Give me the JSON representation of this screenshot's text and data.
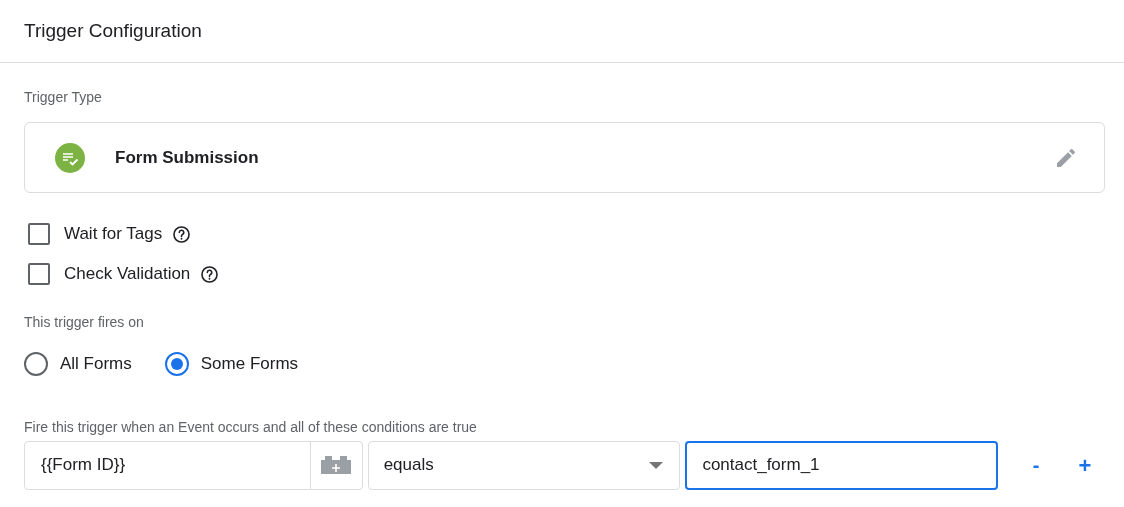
{
  "header": {
    "title": "Trigger Configuration"
  },
  "trigger_type": {
    "label": "Trigger Type",
    "name": "Form Submission"
  },
  "options": [
    {
      "label": "Wait for Tags",
      "checked": false
    },
    {
      "label": "Check Validation",
      "checked": false
    }
  ],
  "fires_on": {
    "label": "This trigger fires on",
    "choices": [
      {
        "label": "All Forms",
        "selected": false
      },
      {
        "label": "Some Forms",
        "selected": true
      }
    ]
  },
  "conditions": {
    "label": "Fire this trigger when an Event occurs and all of these conditions are true",
    "rows": [
      {
        "variable": "{{Form ID}}",
        "operator": "equals",
        "value": "contact_form_1",
        "focused": true,
        "remove": "-",
        "add": "+"
      }
    ]
  }
}
